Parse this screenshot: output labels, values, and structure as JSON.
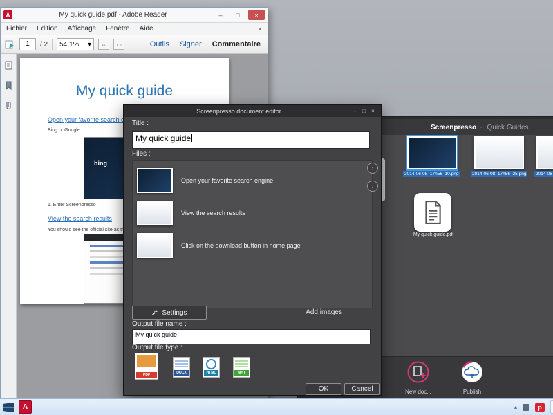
{
  "icons": {
    "minimize": "–",
    "maximize": "□",
    "close": "×",
    "up": "↑",
    "down": "↓",
    "dropdown": "▾",
    "chevron_up": "▴"
  },
  "adobe": {
    "title": "My quick guide.pdf - Adobe Reader",
    "menus": [
      "Fichier",
      "Edition",
      "Affichage",
      "Fenêtre",
      "Aide"
    ],
    "toolbar": {
      "page": "1",
      "page_total": "/ 2",
      "zoom": "54,1%",
      "tools": "Outils",
      "sign": "Signer",
      "comment": "Commentaire"
    },
    "pdf": {
      "heading": "My quick guide",
      "link1": "Open your favorite search engine",
      "caption1": "Bing or Google",
      "bing_logo": "bing",
      "step1": "1. Enter Screenpresso",
      "link2": "View the search results",
      "caption2": "You should see the official site as the first result"
    }
  },
  "dialog": {
    "title": "Screenpresso document editor",
    "title_label": "Title :",
    "title_value": "My quick guide",
    "files_label": "Files :",
    "files": [
      {
        "caption": "Open your favorite search engine"
      },
      {
        "caption": "View the search results"
      },
      {
        "caption": "Click on the download button in home page"
      }
    ],
    "settings": "Settings",
    "add_images": "Add images",
    "output_name_label": "Output file name :",
    "output_name_value": "My quick guide",
    "output_type_label": "Output file type :",
    "types": [
      "PDF",
      "DOCX",
      "HTML",
      "MHT"
    ],
    "ok": "OK",
    "cancel": "Cancel"
  },
  "main": {
    "app": "Screenpresso",
    "sep": "-",
    "workspace": "Quick Guides",
    "thumb1": "2014-06-08_17h56_10.png",
    "thumb2": "2014-06-08_17h56_25.png",
    "thumb3": "2014-06-",
    "pdf_file": "My quick guide.pdf",
    "new_doc": "New doc...",
    "publish": "Publish"
  },
  "tray": {
    "screenpresso_badge": "p"
  }
}
